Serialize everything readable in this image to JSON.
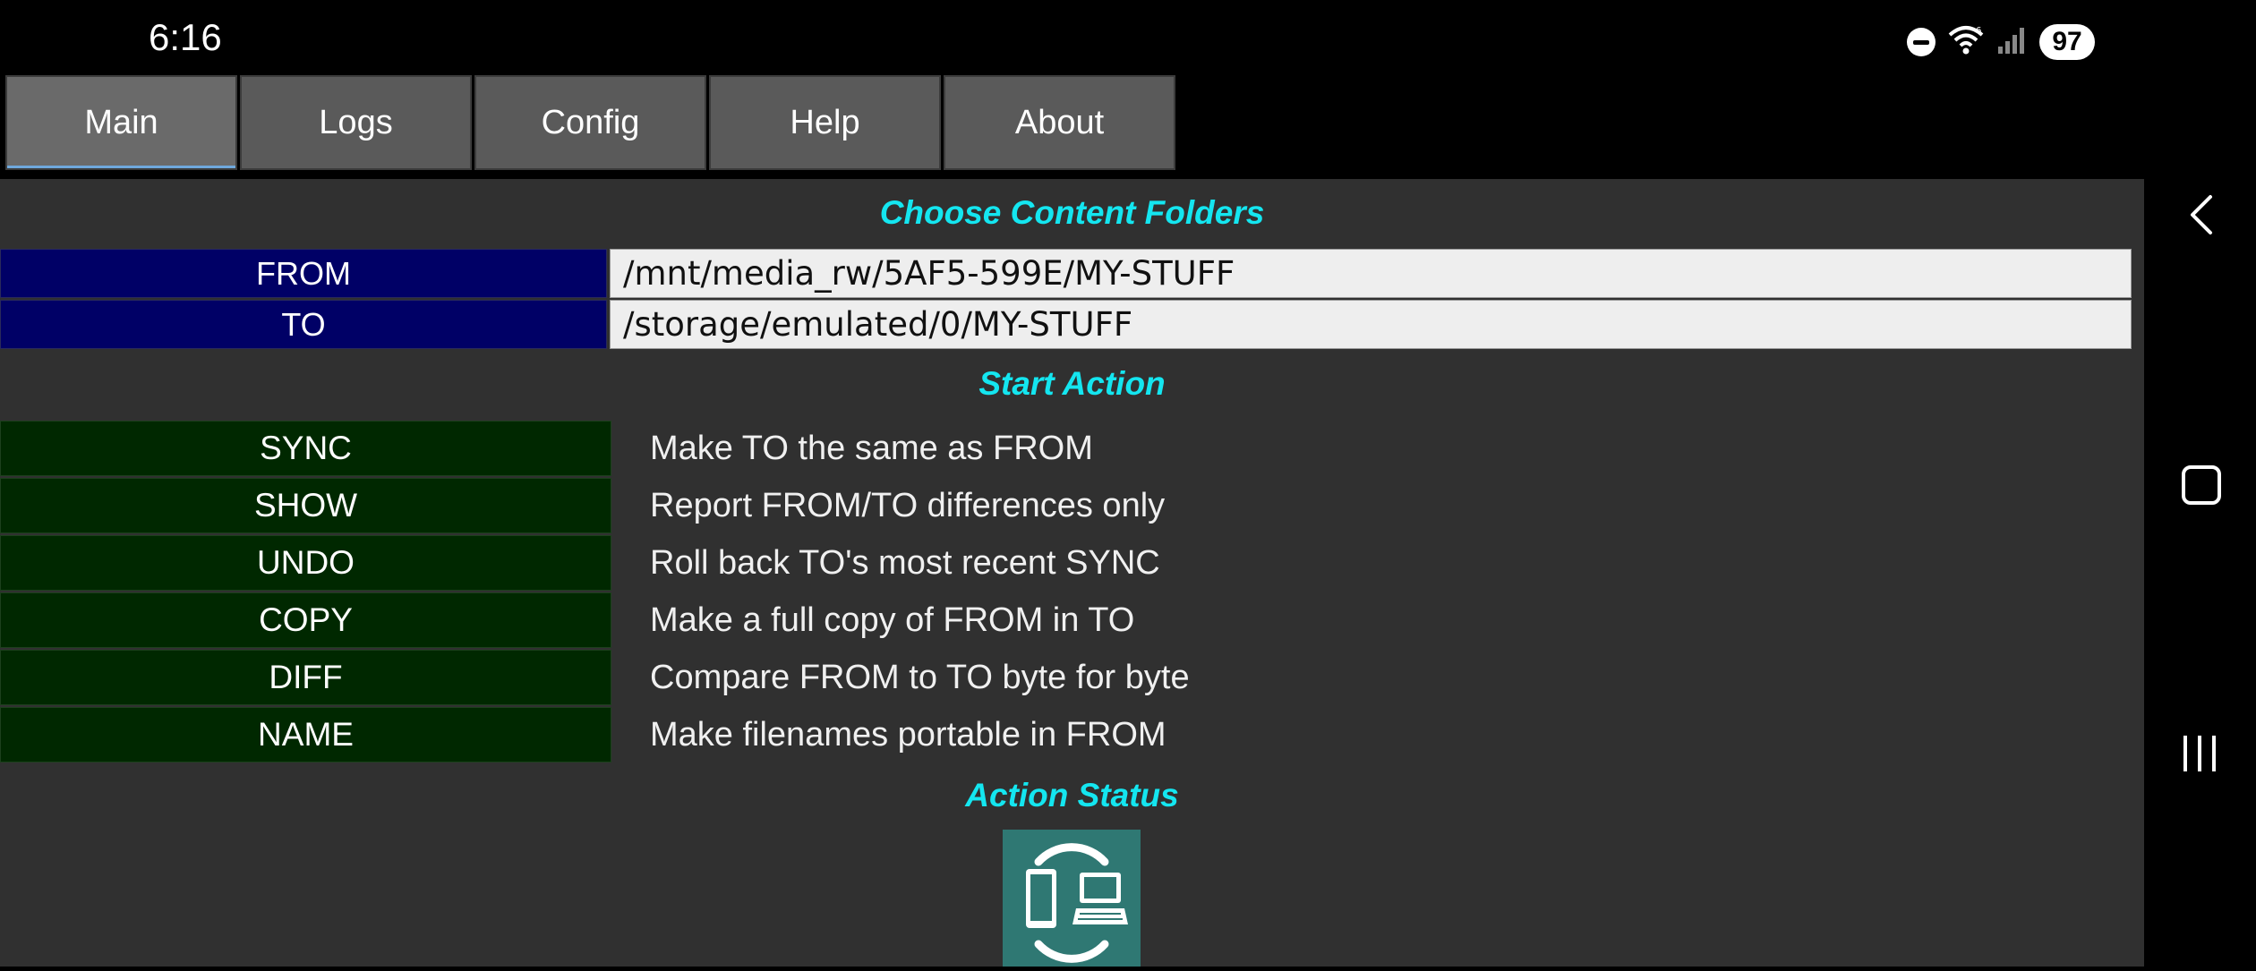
{
  "status_bar": {
    "time": "6:16",
    "icons": [
      "do-not-disturb-icon",
      "wifi-icon",
      "signal-icon"
    ],
    "battery": "97"
  },
  "tabs": [
    {
      "label": "Main",
      "active": true
    },
    {
      "label": "Logs",
      "active": false
    },
    {
      "label": "Config",
      "active": false
    },
    {
      "label": "Help",
      "active": false
    },
    {
      "label": "About",
      "active": false
    }
  ],
  "sections": {
    "folders_title": "Choose Content Folders",
    "action_title": "Start Action",
    "status_title": "Action Status"
  },
  "folders": {
    "from_label": "FROM",
    "from_path": "/mnt/media_rw/5AF5-599E/MY-STUFF",
    "to_label": "TO",
    "to_path": "/storage/emulated/0/MY-STUFF"
  },
  "actions": [
    {
      "label": "SYNC",
      "desc": "Make TO the same as FROM"
    },
    {
      "label": "SHOW",
      "desc": "Report FROM/TO differences only"
    },
    {
      "label": "UNDO",
      "desc": "Roll back TO's most recent SYNC"
    },
    {
      "label": "COPY",
      "desc": "Make a full copy of FROM in TO"
    },
    {
      "label": "DIFF",
      "desc": "Compare FROM to TO byte for byte"
    },
    {
      "label": "NAME",
      "desc": "Make filenames portable in FROM"
    }
  ],
  "colors": {
    "title_cyan": "#14e6f0",
    "folder_label_bg": "#000066",
    "action_btn_bg": "#002800",
    "panel_bg": "#303030",
    "logo_bg": "#2f7873"
  },
  "nav": {
    "icons": [
      "back-icon",
      "home-icon",
      "recents-icon"
    ]
  }
}
